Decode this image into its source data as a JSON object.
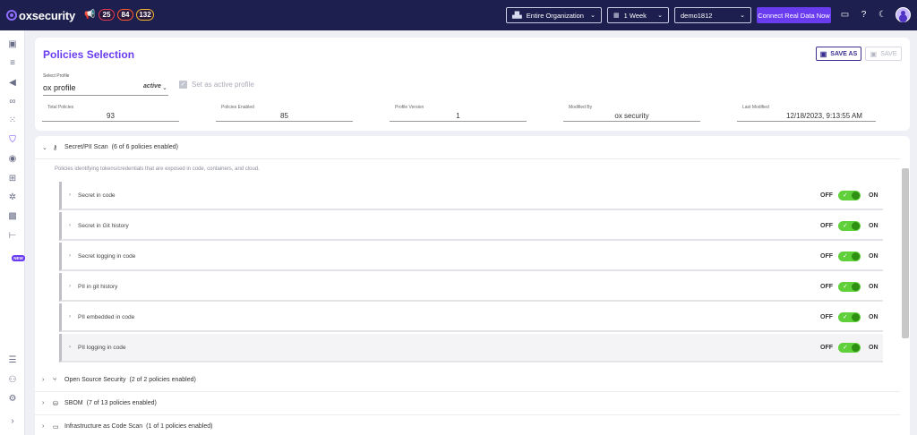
{
  "topbar": {
    "logo_text": "oxsecurity",
    "badges": [
      "25",
      "84",
      "132"
    ],
    "org_select": "Entire Organization",
    "period_select": "1 Week",
    "account_select": "demo1812",
    "connect_button": "Connect Real Data Now",
    "icons": [
      "chat-icon",
      "help-icon",
      "moon-icon",
      "avatar"
    ]
  },
  "sidebar": {
    "icons": [
      "dashboard-icon",
      "list-icon",
      "megaphone-icon",
      "infinity-icon",
      "grid-icon",
      "shield-icon",
      "radar-icon",
      "connections-icon",
      "bug-icon",
      "qr-icon",
      "tree-icon",
      "menu-lines-icon",
      "people-icon",
      "gear-icon",
      "chevron-right-icon"
    ],
    "new_tag": "NEW"
  },
  "header": {
    "title": "Policies Selection",
    "save_as_label": "SAVE AS",
    "save_label": "SAVE",
    "select_profile_label": "Select Profile",
    "profile_value": "ox profile",
    "profile_status": "active",
    "set_active_label": "Set as active profile",
    "stats": [
      {
        "label": "Total Policies",
        "value": "93"
      },
      {
        "label": "Policies Enabled",
        "value": "85"
      },
      {
        "label": "Profile Version",
        "value": "1"
      },
      {
        "label": "Modified By",
        "value": "ox security"
      },
      {
        "label": "Last Modified",
        "value": "12/18/2023, 9:13:55 AM"
      }
    ]
  },
  "groups": {
    "secret": {
      "name": "Secret/PII Scan",
      "count": "(6 of 6 policies enabled)",
      "description": "Policies identifying tokens/credentials that are exposed in code, containers, and cloud."
    },
    "oss": {
      "name": "Open Source Security",
      "count": "(2 of 2 policies enabled)"
    },
    "sbom": {
      "name": "SBOM",
      "count": "(7 of 13 policies enabled)"
    },
    "iac": {
      "name": "Infrastructure as Code Scan",
      "count": "(1 of 1 policies enabled)"
    }
  },
  "policies": [
    {
      "name": "Secret in code"
    },
    {
      "name": "Secret in Git history"
    },
    {
      "name": "Secret logging in code"
    },
    {
      "name": "PII in git history"
    },
    {
      "name": "PII embedded in code"
    },
    {
      "name": "PII logging in code"
    }
  ],
  "toggle": {
    "off_label": "OFF",
    "on_label": "ON",
    "on_color": "#5fd03a"
  },
  "colors": {
    "brand": "#6a3cf0",
    "topbar": "#1d1f4e"
  }
}
